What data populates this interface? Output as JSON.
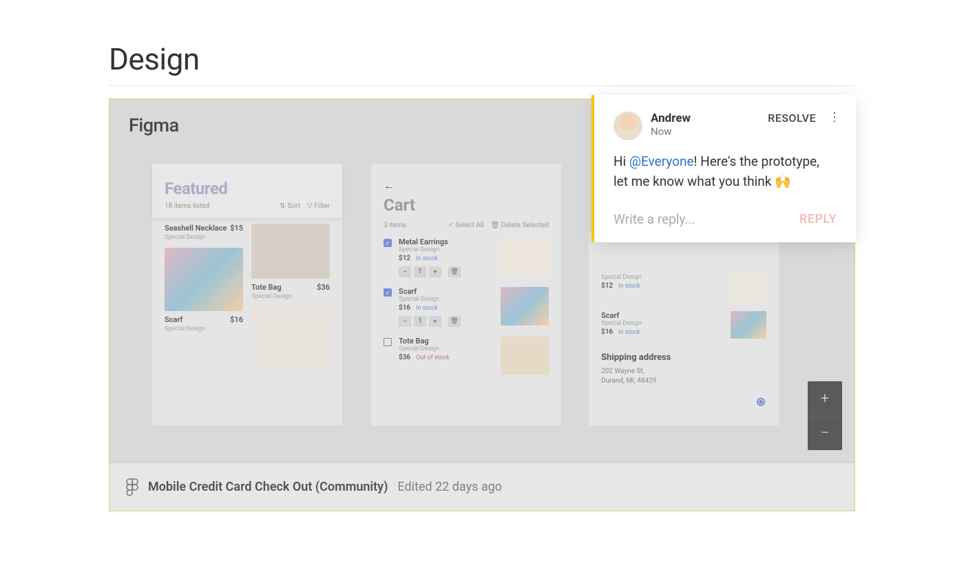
{
  "page": {
    "title": "Design"
  },
  "card": {
    "app_label": "Figma",
    "file_name": "Mobile Credit Card Check Out (Community)",
    "file_edited": "Edited 22 days ago"
  },
  "featured": {
    "title": "Featured",
    "subtitle": "18 items listed",
    "sort_label": "Sort",
    "filter_label": "Filter",
    "products": {
      "seashell": {
        "name": "Seashell Necklace",
        "price": "$15",
        "tag": "Special Design"
      },
      "tote": {
        "name": "Tote Bag",
        "price": "$36",
        "tag": "Special Design"
      },
      "scarf": {
        "name": "Scarf",
        "price": "$16",
        "tag": "Special Design"
      }
    }
  },
  "cart": {
    "title": "Cart",
    "subtitle": "3 items",
    "select_all": "Select All",
    "delete_selected": "Delete Selected",
    "items": {
      "earrings": {
        "name": "Metal Earrings",
        "tag": "Special Design",
        "price": "$12",
        "stock": "In stock",
        "qty": "1"
      },
      "scarf": {
        "name": "Scarf",
        "tag": "Special Design",
        "price": "$16",
        "stock": "In stock",
        "qty": "1"
      },
      "tote": {
        "name": "Tote Bag",
        "tag": "Special Design",
        "price": "$36",
        "stock": "Out of stock"
      }
    }
  },
  "rightcol": {
    "items": {
      "a": {
        "tag": "Special Design",
        "price": "$12",
        "stock": "In stock"
      },
      "b": {
        "name": "Scarf",
        "tag": "Special Design",
        "price": "$16",
        "stock": "In stock"
      }
    },
    "shipping_title": "Shipping address",
    "address_line1": "202 Wayne St,",
    "address_line2": "Durand, MI, 48429"
  },
  "comment": {
    "author": "Andrew",
    "time": "Now",
    "resolve": "RESOLVE",
    "body_pre": "Hi ",
    "mention": "@Everyone",
    "body_post": "! Here's the prototype, let me know what you think ",
    "emoji": "🙌",
    "reply_placeholder": "Write a reply...",
    "reply_btn": "REPLY"
  },
  "zoom": {
    "in": "+",
    "out": "−"
  }
}
